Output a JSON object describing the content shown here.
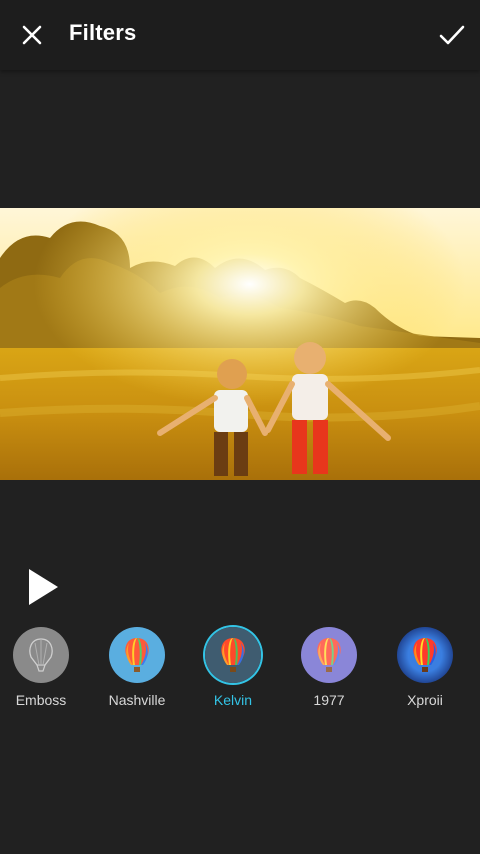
{
  "header": {
    "title": "Filters"
  },
  "icons": {
    "close": "close-icon",
    "confirm": "check-icon",
    "play": "play-icon"
  },
  "colors": {
    "accent": "#33c4e6",
    "background": "#212121",
    "toolbar": "#1d1d1d"
  },
  "filters": [
    {
      "label": "Emboss",
      "selected": false
    },
    {
      "label": "Nashville",
      "selected": false
    },
    {
      "label": "Kelvin",
      "selected": true
    },
    {
      "label": "1977",
      "selected": false
    },
    {
      "label": "Xproii",
      "selected": false
    }
  ]
}
